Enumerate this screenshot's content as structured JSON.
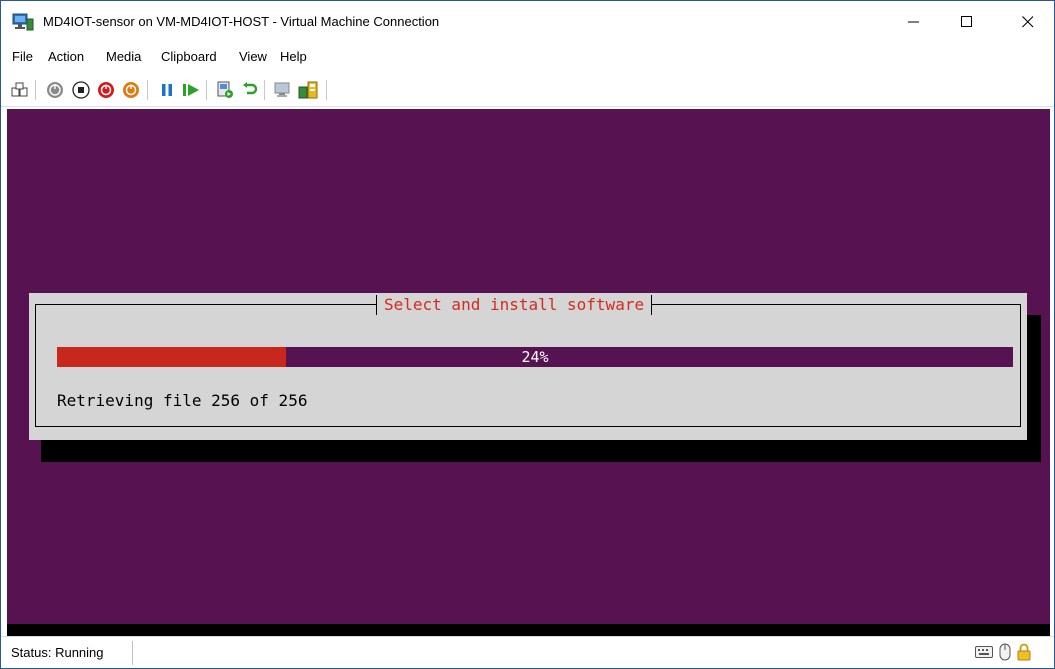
{
  "window": {
    "title": "MD4IOT-sensor on VM-MD4IOT-HOST - Virtual Machine Connection",
    "controls": {
      "minimize": "—",
      "maximize": "☐",
      "close": "✕"
    }
  },
  "menu": {
    "file": "File",
    "action": "Action",
    "media": "Media",
    "clipboard": "Clipboard",
    "view": "View",
    "help": "Help"
  },
  "toolbar": {
    "icons": [
      "ctrl-alt-del-icon",
      "start-icon",
      "turn-off-icon",
      "shut-down-icon",
      "save-icon",
      "pause-icon",
      "resume-icon",
      "checkpoint-icon",
      "revert-icon",
      "enhanced-session-icon",
      "share-icon"
    ]
  },
  "installer": {
    "title": "Select and install software",
    "progress_percent": 24,
    "progress_text": "24%",
    "status_line": "Retrieving file 256 of 256"
  },
  "statusbar": {
    "status": "Status: Running"
  },
  "colors": {
    "screen_bg": "#571351",
    "progress_fill": "#c8271c",
    "dialog_bg": "#d5d5d5",
    "title_text": "#d42b1e"
  }
}
